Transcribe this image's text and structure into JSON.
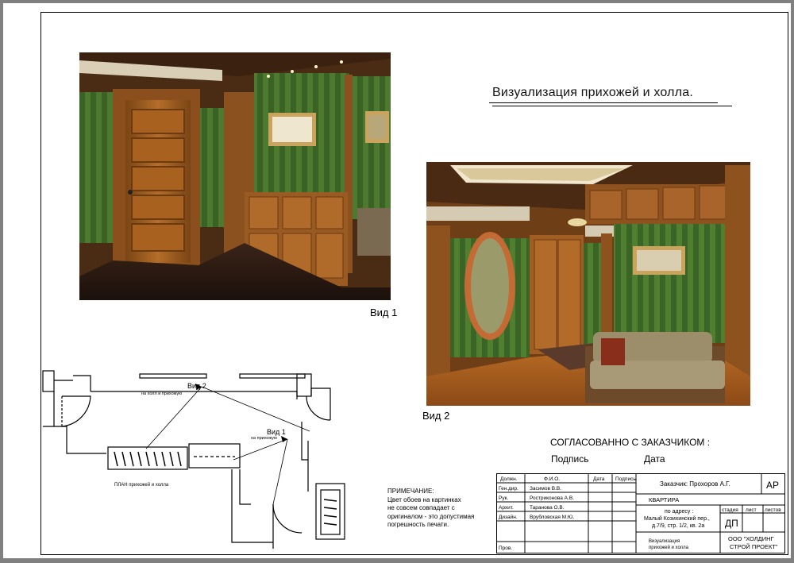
{
  "title": "Визуализация прихожей и холла.",
  "views": {
    "view1": "Вид 1",
    "view2": "Вид 2"
  },
  "plan": {
    "label": "ПЛАН прихожей и холла",
    "view1_label": "Вид 1",
    "view1_sub": "на прихожую",
    "view2_label": "Вид 2",
    "view2_sub": "на холл и прихожую"
  },
  "approval": {
    "heading": "СОГЛАСОВАННО С ЗАКАЗЧИКОМ :",
    "signature": "Подпись",
    "date": "Дата"
  },
  "note": {
    "heading": "ПРИМЕЧАНИЕ:",
    "lines": [
      "Цвет обоев на картинках",
      "не совсем совпадает с",
      "оригиналом - это допустимая",
      "погрешность печати."
    ]
  },
  "stamp": {
    "headers": {
      "position": "Должн.",
      "name": "Ф.И.О.",
      "date": "Дата",
      "signature": "Подпись"
    },
    "rows": [
      {
        "role": "Ген.дир.",
        "name": "Засимов В.В."
      },
      {
        "role": "Рук.",
        "name": "Ростриконова А.В."
      },
      {
        "role": "Архит.",
        "name": "Таранова О.В."
      },
      {
        "role": "Дизайн.",
        "name": "Врубловская М.Ю."
      },
      {
        "role": "Пров.",
        "name": ""
      }
    ],
    "customer": "Заказчик:   Прохоров А.Г.",
    "code": "АР",
    "object": "КВАРТИРА",
    "address_lines": [
      "по адресу :",
      "Малый Козихинский пер.,",
      "д.7/9, стр. 1/2, кв. 2а"
    ],
    "stage_header": "стадия",
    "sheet_header": "лист",
    "sheets_header": "листов",
    "stage": "ДП",
    "drawing_title_lines": [
      "Визуализация",
      "прихожей и холла"
    ],
    "company_lines": [
      "ООО \"ХОЛДИНГ",
      "СТРОЙ ПРОЕКТ\""
    ]
  }
}
